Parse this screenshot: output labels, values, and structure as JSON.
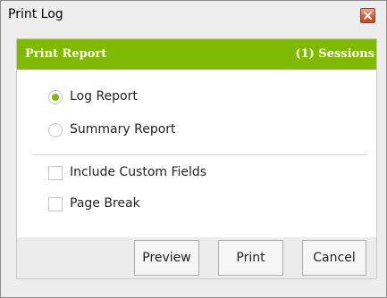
{
  "window": {
    "title": "Print Log",
    "close_icon": "close-icon"
  },
  "panel": {
    "header_title": "Print Report",
    "header_sessions": "(1) Sessions",
    "accent_color": "#7fba00"
  },
  "report_options": [
    {
      "label": "Log Report",
      "selected": true
    },
    {
      "label": "Summary Report",
      "selected": false
    }
  ],
  "checkbox_options": [
    {
      "label": "Include Custom Fields",
      "checked": false
    },
    {
      "label": "Page Break",
      "checked": false
    }
  ],
  "buttons": {
    "preview_label": "Preview",
    "print_label": "Print",
    "cancel_label": "Cancel"
  }
}
